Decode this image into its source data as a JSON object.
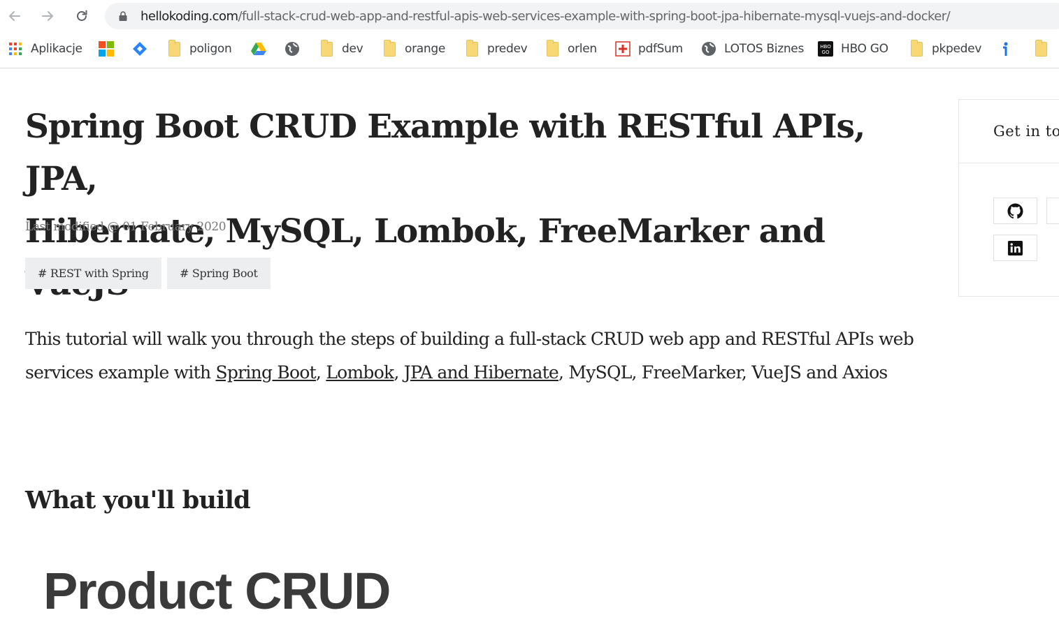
{
  "browser": {
    "url_host": "hellokoding.com",
    "url_path": "/full-stack-crud-web-app-and-restful-apis-web-services-example-with-spring-boot-jpa-hibernate-mysql-vuejs-and-docker/"
  },
  "bookmarks": [
    {
      "label": "Aplikacje",
      "icon": "apps-icon"
    },
    {
      "label": "",
      "icon": "microsoft-icon"
    },
    {
      "label": "",
      "icon": "jira-icon"
    },
    {
      "label": "poligon",
      "icon": "folder-icon"
    },
    {
      "label": "",
      "icon": "google-drive-icon"
    },
    {
      "label": "",
      "icon": "globe-icon"
    },
    {
      "label": "dev",
      "icon": "folder-icon"
    },
    {
      "label": "orange",
      "icon": "folder-icon"
    },
    {
      "label": "predev",
      "icon": "folder-icon"
    },
    {
      "label": "orlen",
      "icon": "folder-icon"
    },
    {
      "label": "pdfSum",
      "icon": "pdfsum-icon"
    },
    {
      "label": "LOTOS Biznes",
      "icon": "globe-icon"
    },
    {
      "label": "HBO GO",
      "icon": "hbo-go-icon"
    },
    {
      "label": "pkpedev",
      "icon": "folder-icon"
    },
    {
      "label": "",
      "icon": "info-icon"
    }
  ],
  "article": {
    "title_line1": "Spring Boot CRUD Example with RESTful APIs, JPA,",
    "title_line2": "Hibernate, MySQL, Lombok, FreeMarker and VueJS",
    "last_modified": "Last modified @ 01 February 2020",
    "tags": [
      "# REST with Spring",
      "# Spring Boot"
    ],
    "intro": {
      "before": "This tutorial will walk you through the steps of building a full-stack CRUD web app and RESTful APIs web services example with ",
      "link1": "Spring Boot",
      "sep1": ", ",
      "link2": "Lombok",
      "sep2": ", ",
      "link3": "JPA and Hibernate",
      "after": ", MySQL, FreeMarker, VueJS and Axios"
    },
    "section_heading": "What you'll build",
    "demo_image_text": "Product CRUD"
  },
  "sidebar": {
    "title": "Get in to",
    "social": [
      "github-icon",
      "linkedin-icon"
    ]
  },
  "colors": {
    "page_bg": "#ffffff",
    "text": "#222222",
    "muted": "#777777",
    "tag_bg": "#eceeef",
    "omnibox_bg": "#f1f3f4",
    "folder": "#f8d775"
  }
}
